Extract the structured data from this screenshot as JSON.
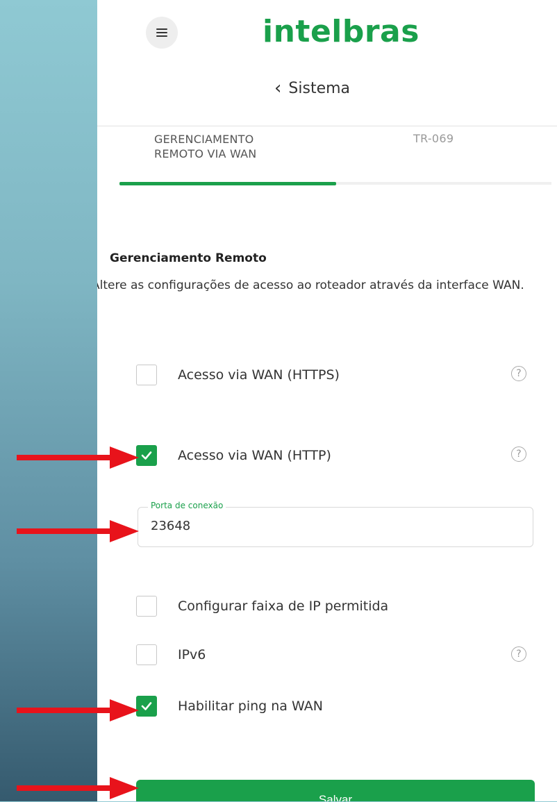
{
  "header": {
    "menu_icon": "hamburger-icon",
    "logo": "intelbras",
    "back_icon": "chevron-left-icon",
    "back_label": "Sistema"
  },
  "tabs": [
    {
      "label_line1": "GERENCIAMENTO",
      "label_line2": "REMOTO VIA WAN",
      "active": true
    },
    {
      "label": "TR-069",
      "active": false
    }
  ],
  "section": {
    "title": "Gerenciamento Remoto",
    "description": "Altere as configurações de acesso ao roteador através da interface WAN."
  },
  "options": [
    {
      "label": "Acesso via WAN (HTTPS)",
      "checked": false,
      "help": true
    },
    {
      "label": "Acesso via WAN (HTTP)",
      "checked": true,
      "help": true
    },
    {
      "label": "Configurar faixa de IP permitida",
      "checked": false,
      "help": false
    },
    {
      "label": "IPv6",
      "checked": false,
      "help": true
    },
    {
      "label": "Habilitar ping na WAN",
      "checked": true,
      "help": false
    }
  ],
  "port_field": {
    "label": "Porta de conexão",
    "value": "23648"
  },
  "save_label": "Salvar",
  "colors": {
    "accent": "#1aa04b",
    "annotation_arrow": "#e8131b"
  }
}
